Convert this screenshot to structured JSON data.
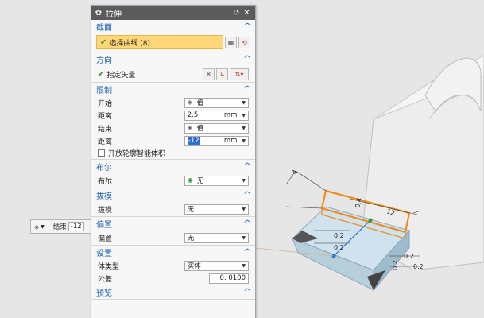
{
  "dialog": {
    "title": "拉伸",
    "title_icon": "gear-icon",
    "reset_icon": "reset-icon",
    "close_icon": "close-icon"
  },
  "sections": {
    "section_profile": {
      "label": "截面",
      "select_curve": "选择曲线 (8)"
    },
    "section_direction": {
      "label": "方向",
      "vector": "指定矢量"
    },
    "section_limits": {
      "label": "限制",
      "start_label": "开始",
      "start_value": "值",
      "start_distance_label": "距离",
      "start_distance_value": "2.5",
      "start_distance_unit": "mm",
      "end_label": "结束",
      "end_value": "值",
      "end_distance_label": "距离",
      "end_distance_value": "-12",
      "end_distance_unit": "mm",
      "open_profile": "开放轮廓智能体积"
    },
    "section_boolean": {
      "label": "布尔",
      "boolean_label": "布尔",
      "boolean_value": "无"
    },
    "section_draft": {
      "label": "拔模",
      "draft_label": "拔模",
      "draft_value": "无"
    },
    "section_offset": {
      "label": "偏置",
      "offset_label": "偏置",
      "offset_value": "无"
    },
    "section_settings": {
      "label": "设置",
      "body_type_label": "体类型",
      "body_type_value": "实体",
      "tolerance_label": "公差",
      "tolerance_value": "0. 0100"
    },
    "section_preview": {
      "label": "预览"
    }
  },
  "floatbar": {
    "label": "结束",
    "value": "-12"
  },
  "viewport": {
    "dim_12": "12",
    "dim_4": "4",
    "dim_02a": "0.2",
    "dim_02b": "0.2",
    "dim_02c": "0.2",
    "dim_02d": "0.2",
    "dim_02e": "0.2",
    "dim_04": "0.4"
  },
  "colors": {
    "accent": "#1f63b0",
    "highlight": "#ffd779",
    "profile": "#f08c1e",
    "solid": "#c6dbe8"
  }
}
